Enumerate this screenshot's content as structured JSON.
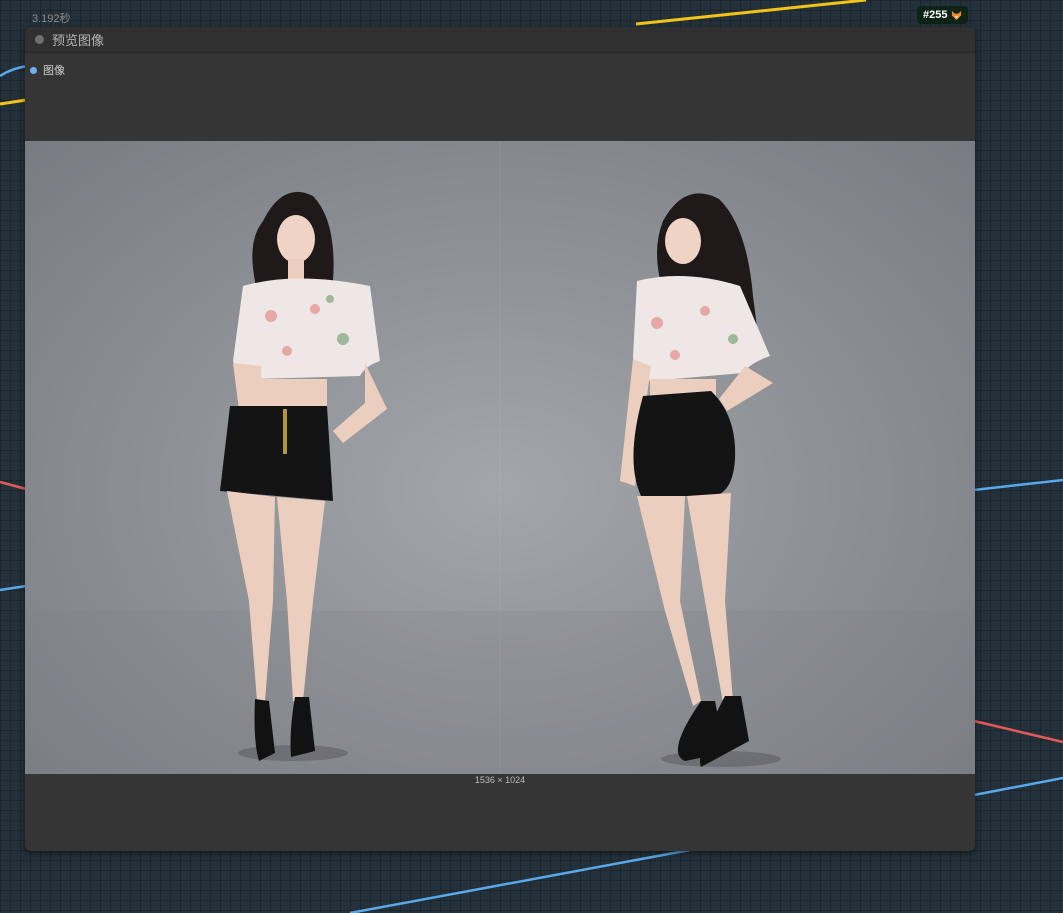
{
  "canvas": {
    "execution_time": "3.192秒",
    "node_id": "#255",
    "badge_icon": "fox-icon"
  },
  "node": {
    "title": "预览图像",
    "inputs": [
      {
        "label": "图像",
        "color": "#6fb1f0"
      }
    ],
    "preview": {
      "image_size": "1536 × 1024"
    }
  },
  "colors": {
    "canvas_background": "#24313a",
    "node_body": "#353535",
    "node_header": "#303030",
    "badge_background": "#0d2316",
    "link_yellow": "#f2c417",
    "link_blue": "#5aa8ec",
    "link_red": "#e45a5a"
  }
}
